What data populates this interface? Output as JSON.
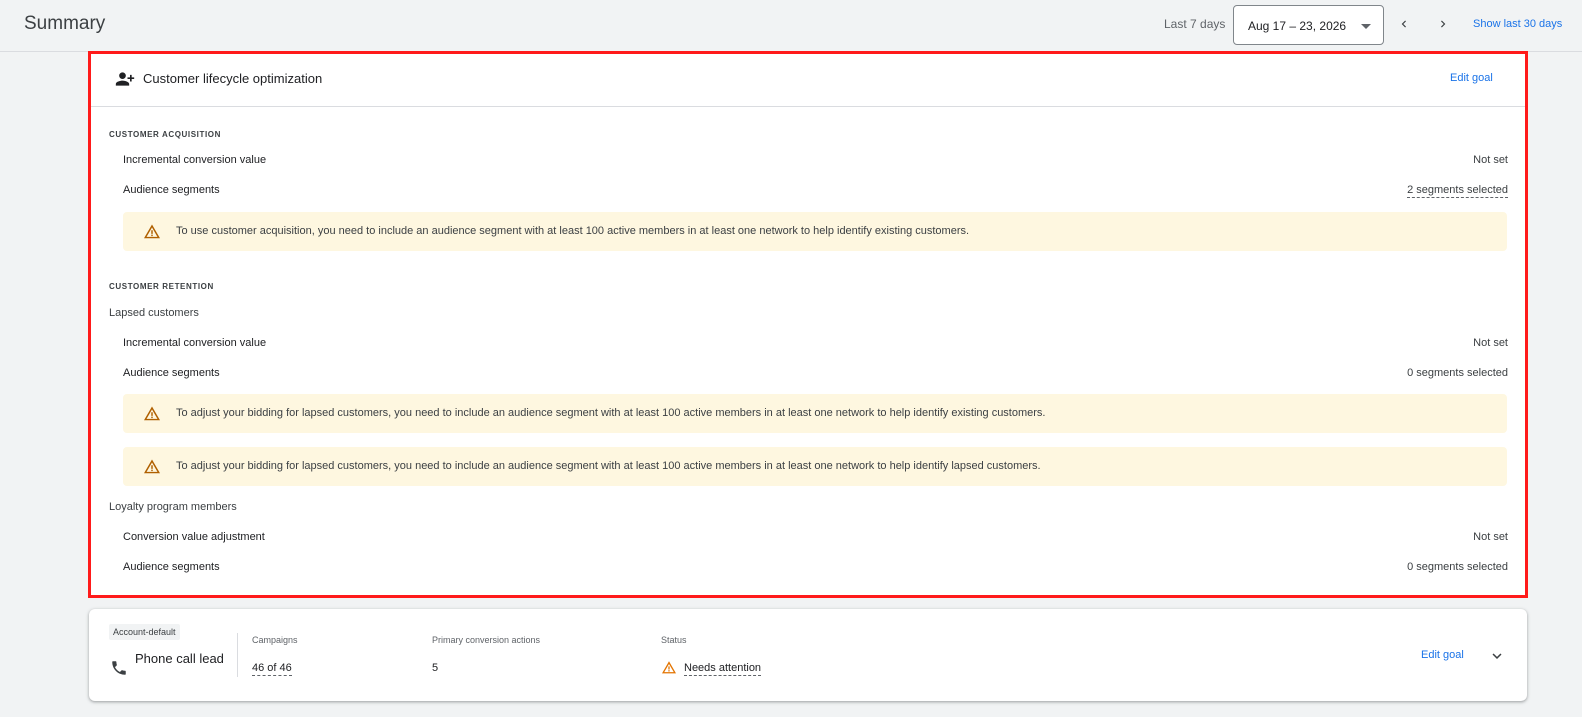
{
  "header": {
    "title": "Summary",
    "range_label": "Last 7 days",
    "date_range": "Aug 17 – 23, 2026",
    "show_last_link": "Show last 30 days"
  },
  "goal_card": {
    "title": "Customer lifecycle optimization",
    "edit_label": "Edit goal",
    "acquisition": {
      "section_label": "CUSTOMER ACQUISITION",
      "incremental_label": "Incremental conversion value",
      "incremental_value": "Not set",
      "segments_label": "Audience segments",
      "segments_value": "2 segments selected",
      "warning": "To use customer acquisition, you need to include an audience segment with at least 100 active members in at least one network to help identify existing customers."
    },
    "retention": {
      "section_label": "CUSTOMER RETENTION",
      "lapsed": {
        "label": "Lapsed customers",
        "incremental_label": "Incremental conversion value",
        "incremental_value": "Not set",
        "segments_label": "Audience segments",
        "segments_value": "0 segments selected",
        "warning_1": "To adjust your bidding for lapsed customers, you need to include an audience segment with at least 100 active members in at least one network to help identify existing customers.",
        "warning_2": "To adjust your bidding for lapsed customers, you need to include an audience segment with at least 100 active members in at least one network to help identify lapsed customers."
      },
      "loyalty": {
        "label": "Loyalty program members",
        "adjustment_label": "Conversion value adjustment",
        "adjustment_value": "Not set",
        "segments_label": "Audience segments",
        "segments_value": "0 segments selected"
      }
    }
  },
  "account_card": {
    "badge": "Account-default",
    "goal_name": "Phone call lead",
    "campaigns_label": "Campaigns",
    "campaigns_value": "46 of 46",
    "primary_label": "Primary conversion actions",
    "primary_value": "5",
    "status_label": "Status",
    "status_value": "Needs attention",
    "edit_label": "Edit goal"
  },
  "colors": {
    "accent": "#1a73e8",
    "highlight_border": "#ff1a1a",
    "warning_bg": "#fef7e0",
    "warning_icon": "#b06000"
  },
  "icons": [
    "person-add-icon",
    "warning-icon",
    "phone-icon",
    "chevron-down-icon",
    "chevron-left-icon",
    "chevron-right-icon",
    "caret-down-icon"
  ]
}
